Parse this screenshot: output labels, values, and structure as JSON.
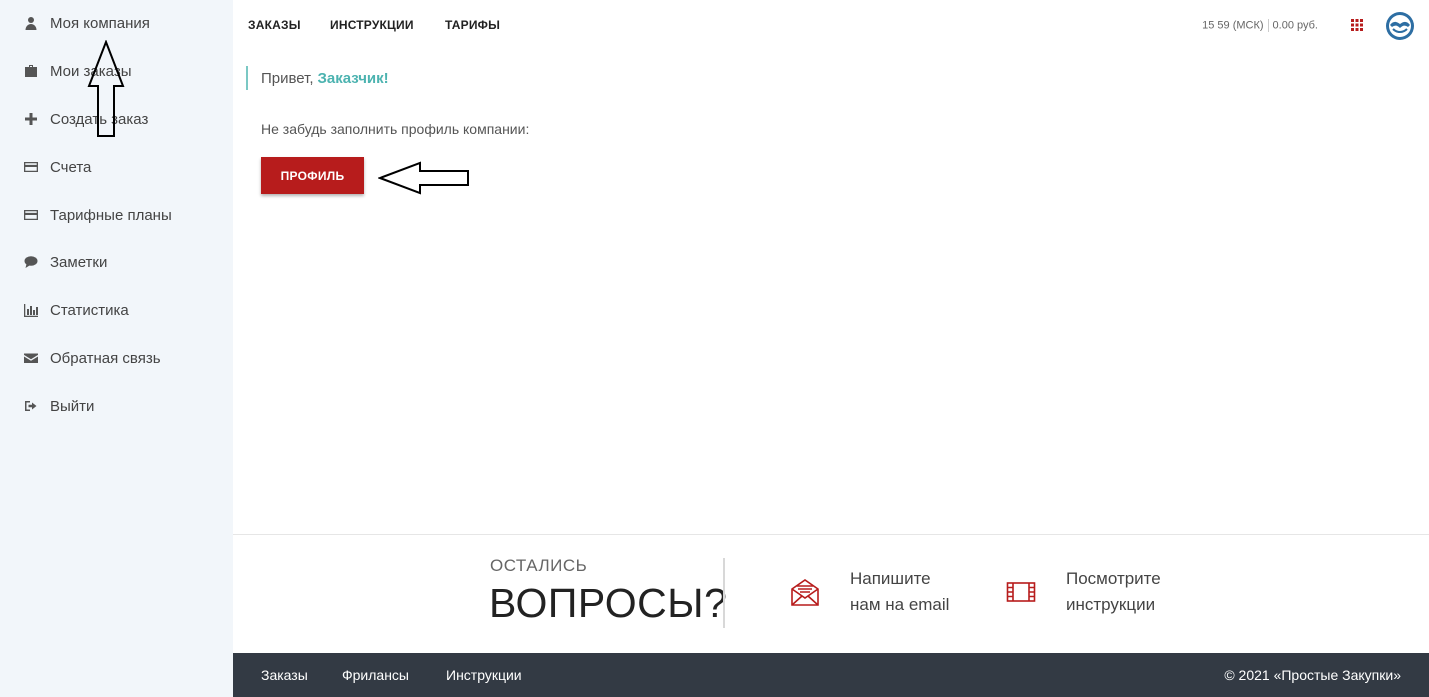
{
  "sidebar": {
    "items": [
      {
        "label": "Моя компания",
        "icon": "user-icon"
      },
      {
        "label": "Мои заказы",
        "icon": "briefcase-icon"
      },
      {
        "label": "Создать заказ",
        "icon": "plus-icon"
      },
      {
        "label": "Счета",
        "icon": "credit-card-icon"
      },
      {
        "label": "Тарифные планы",
        "icon": "credit-card-icon"
      },
      {
        "label": "Заметки",
        "icon": "comment-icon"
      },
      {
        "label": "Статистика",
        "icon": "bar-chart-icon"
      },
      {
        "label": "Обратная связь",
        "icon": "envelope-icon"
      },
      {
        "label": "Выйти",
        "icon": "sign-out-icon"
      }
    ]
  },
  "topnav": {
    "links": [
      "ЗАКАЗЫ",
      "ИНСТРУКЦИИ",
      "ТАРИФЫ"
    ],
    "time": "15 59 (МСК)",
    "balance": "0.00 руб."
  },
  "main": {
    "greeting_prefix": "Привет,",
    "greeting_name": "Заказчик!",
    "hint": "Не забудь заполнить профиль компании:",
    "profile_button": "ПРОФИЛЬ"
  },
  "questions": {
    "small": "ОСТАЛИСЬ",
    "big": "ВОПРОСЫ?",
    "email_line1": "Напишите",
    "email_line2": "нам на email",
    "instr_line1": "Посмотрите",
    "instr_line2": "инструкции"
  },
  "footer": {
    "links": [
      "Заказы",
      "Фрилансы",
      "Инструкции"
    ],
    "copyright": "© 2021 «Простые Закупки»"
  },
  "colors": {
    "accent_red": "#b71c1c",
    "accent_teal": "#4cb3b0",
    "sidebar_bg": "#f2f6fa",
    "footer_bg": "#333a44"
  }
}
